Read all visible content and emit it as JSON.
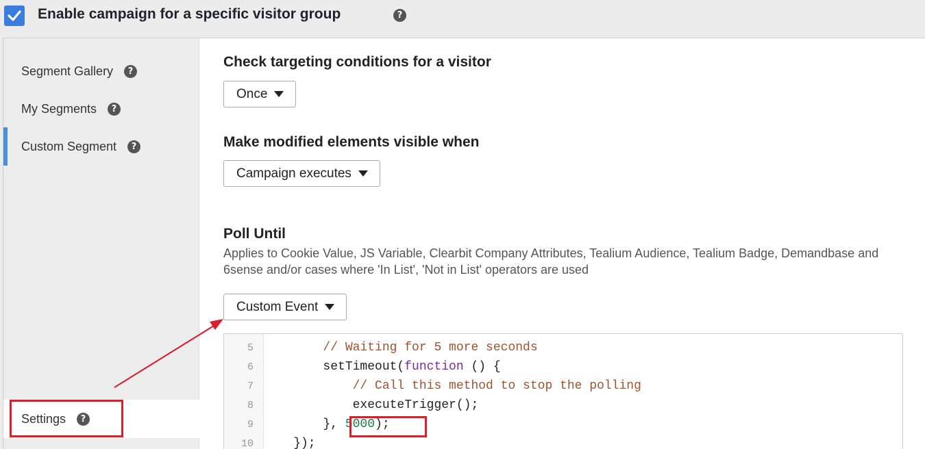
{
  "header": {
    "title": "Enable campaign for a specific visitor group",
    "checked": true,
    "help": "?"
  },
  "sidebar": {
    "items": [
      {
        "label": "Segment Gallery",
        "help": "?"
      },
      {
        "label": "My Segments",
        "help": "?"
      },
      {
        "label": "Custom Segment",
        "help": "?"
      }
    ],
    "settings": {
      "label": "Settings",
      "help": "?"
    }
  },
  "main": {
    "targeting": {
      "title": "Check targeting conditions for a visitor",
      "value": "Once"
    },
    "visible": {
      "title": "Make modified elements visible when",
      "value": "Campaign executes"
    },
    "poll": {
      "title": "Poll Until",
      "desc": "Applies to Cookie Value, JS Variable, Clearbit Company Attributes, Tealium Audience, Tealium Badge, Demandbase and 6sense and/or cases where 'In List', 'Not in List' operators are used",
      "value": "Custom Event"
    }
  },
  "code": {
    "lines": [
      {
        "n": "5",
        "text": "        // Waiting for 5 more seconds"
      },
      {
        "n": "6",
        "pre": "        setTimeout(",
        "kw": "function",
        "post": " () {"
      },
      {
        "n": "7",
        "text": "            // Call this method to stop the polling"
      },
      {
        "n": "8",
        "text": "            executeTrigger();"
      },
      {
        "n": "9",
        "pre": "        }, ",
        "num": "5000",
        "post": ");"
      },
      {
        "n": "10",
        "text": "    });"
      }
    ]
  },
  "colors": {
    "accent": "#3b7ddd",
    "annotation": "#d9202a",
    "active_marker": "#4a90d9"
  }
}
